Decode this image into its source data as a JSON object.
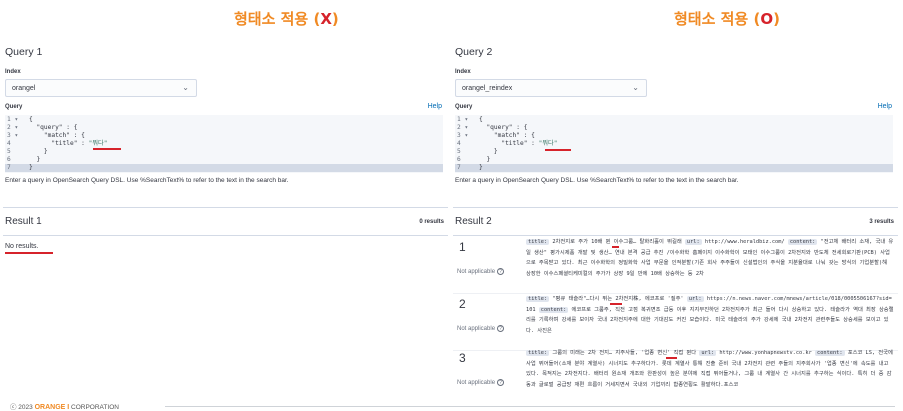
{
  "headings": {
    "left": {
      "prefix": "형태소 적용 (",
      "mark": "X",
      "suffix": ")"
    },
    "right": {
      "prefix": "형태소 적용 (",
      "mark": "O",
      "suffix": ")"
    }
  },
  "common": {
    "index_label": "Index",
    "query_label": "Query",
    "help_label": "Help",
    "hint": "Enter a query in OpenSearch Query DSL. Use %SearchText% to refer to the text in the search bar.",
    "not_applicable": "Not applicable"
  },
  "left": {
    "query_title": "Query 1",
    "index_value": "orangel",
    "editor_lines": [
      {
        "num": "1 ▾",
        "code": "{"
      },
      {
        "num": "2 ▾",
        "code": "  \"query\" : {"
      },
      {
        "num": "3 ▾",
        "code": "    \"match\" : {"
      },
      {
        "num": "4",
        "code": "      \"title\" : ",
        "str": "\"뭐다\""
      },
      {
        "num": "5",
        "code": "    }"
      },
      {
        "num": "6",
        "code": "  }"
      },
      {
        "num": "7",
        "code": "}"
      }
    ],
    "result_title": "Result 1",
    "result_count": "0 results",
    "no_results": "No results."
  },
  "right": {
    "query_title": "Query 2",
    "index_value": "orangel_reindex",
    "editor_lines": [
      {
        "num": "1 ▾",
        "code": "{"
      },
      {
        "num": "2 ▾",
        "code": "  \"query\" : {"
      },
      {
        "num": "3 ▾",
        "code": "    \"match\" : {"
      },
      {
        "num": "4",
        "code": "      \"title\" : ",
        "str": "\"뭐다\""
      },
      {
        "num": "5",
        "code": "    }"
      },
      {
        "num": "6",
        "code": "  }"
      },
      {
        "num": "7",
        "code": "}"
      }
    ],
    "result_title": "Result 2",
    "result_count": "3 results",
    "results": [
      {
        "num": "1",
        "title_key": "title:",
        "title": "2차전지로 주가 10배 뛴 이수그룹… 탈화리홀이 뛰길래",
        "url_key": "url:",
        "url": "http://www.heraldbiz.com/",
        "content_key": "content:",
        "content": "\"전고체 배터리 소재, 국내 유일 생산\" 평가시제품 개발 및 생산… 연내 본격 공급 추진 /이수화학 홈페이지 이수화학이 모태인 이수그룹이 2차전지와 반도체 전세회로기판(PCB) 사업으로 주목받고 있다. 최근 이수화학의 정밀화학 사업 부문을 인적분할(기존 회사 주주들이 신설법인의 주식을 지분율대로 나눠 갖는 방식의 기업분할)해 상장한 이수스페셜티케미컬의 주가가 상장 9일 만에 10배 상승하는 등 2차"
      },
      {
        "num": "2",
        "title_key": "title:",
        "title": "\"평큐 태슬라\"…다시 뛰는 2차전지株, 에코프로 '질주'",
        "url_key": "url:",
        "url": "https://n.news.naver.com/mnews/article/018/0005506167?sid=101",
        "content_key": "content:",
        "content": "에코프로 그룹주, 직전 고점 복귀면조 급등 이후 지지부진하던 2차전지주가 최근 들어 다시 상승하고 있다. 테슬라가 역대 최장 상승랠리를 기록하며 강세를 보이자 국내 2차전지주에 대한 기대감도 커진 모습이다. 미국 테슬라의 주가 강세에 국내 2차전지 관련주들도 상승세를 보이고 있다. 사진은"
      },
      {
        "num": "3",
        "title_key": "title:",
        "title": "그룹의 미래는 2차 전지… 지주사들, '업종 변신' 직접 뛴다",
        "url_key": "url:",
        "url": "http://www.yonhapnewstv.co.kr",
        "content_key": "content:",
        "content": "포스코 LS, 전국에 사업 뛰어들어(소재 분야 계열사) 시너지도 추구하다가. 롯데 계열사 통해 진출 준비 국내 2차전지 관련 주들의 지주회사가 '업종 변신'에 속도를 내고 있다. 목적지는 2차전지다. 배터리 원소재 개조와 완판성이 높은 분야에 직접 뛰어들거나, 그룹 내 계열사 간 시너지를 추구하는 식이다. 특히 더 중 감동과 글로벌 공급망 재편 흐름이 거세지면서 국내외 기업끼리 합종연횡도 활발하다.포스코"
      }
    ]
  },
  "footer": {
    "copyright": "ⓒ 2023",
    "brand": "ORANGE I",
    "corp": "CORPORATION"
  },
  "colors": {
    "accent": "#f08a24",
    "mark": "#d6232b",
    "link": "#006bb4"
  }
}
